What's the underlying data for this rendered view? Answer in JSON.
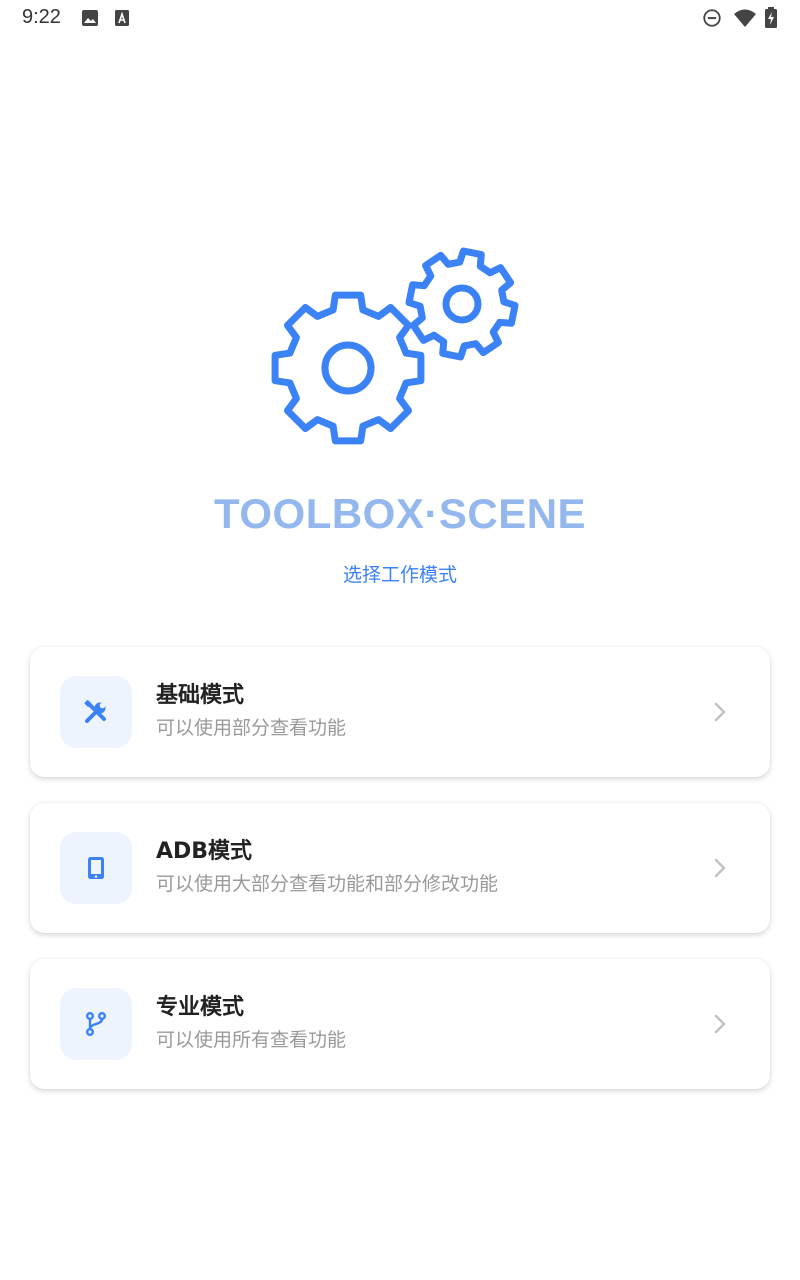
{
  "status_bar": {
    "time": "9:22",
    "left_icons": [
      "image-icon",
      "font-a-icon"
    ],
    "right_icons": [
      "do-not-disturb-icon",
      "wifi-icon",
      "battery-charging-icon"
    ]
  },
  "app": {
    "title": "TOOLBOX·SCENE",
    "subtitle": "选择工作模式",
    "logo_icon": "gears-icon",
    "accent_color": "#3b82f6",
    "title_color": "#94b8ee"
  },
  "modes": [
    {
      "title": "基础模式",
      "description": "可以使用部分查看功能",
      "icon": "tools-icon"
    },
    {
      "title": "ADB模式",
      "description": "可以使用大部分查看功能和部分修改功能",
      "icon": "tablet-icon"
    },
    {
      "title": "专业模式",
      "description": "可以使用所有查看功能",
      "icon": "branch-icon"
    }
  ]
}
